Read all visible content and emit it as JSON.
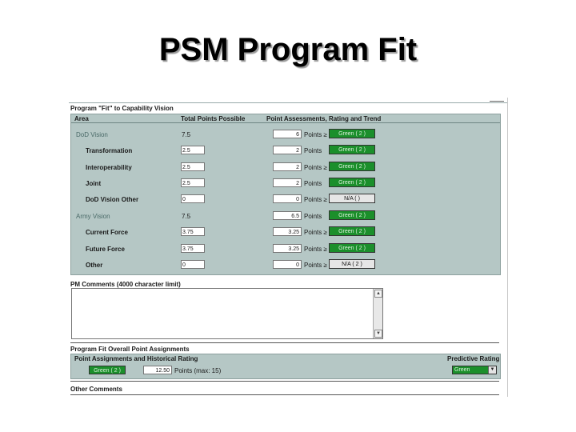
{
  "slide": {
    "title": "PSM Program Fit"
  },
  "capability": {
    "section_title": "Program \"Fit\" to Capability Vision",
    "headers": {
      "area": "Area",
      "total": "Total Points Possible",
      "assessment": "Point Assessments, Rating and Trend"
    },
    "rows": [
      {
        "area": "DoD Vision",
        "total": "7.5",
        "points": "6",
        "unit": "Points",
        "rating": "Green ( 2 )",
        "status": "green"
      },
      {
        "area": "Transformation",
        "total": "2.5",
        "points": "2",
        "unit": "Points",
        "rating": "Green ( 2 )",
        "status": "green"
      },
      {
        "area": "Interoperability",
        "total": "2.5",
        "points": "2",
        "unit": "Points",
        "rating": "Green ( 2 )",
        "status": "green"
      },
      {
        "area": "Joint",
        "total": "2.5",
        "points": "2",
        "unit": "Points",
        "rating": "Green ( 2 )",
        "status": "green"
      },
      {
        "area": "DoD Vision Other",
        "total": "0",
        "points": "0",
        "unit": "Points",
        "rating": "N/A ( )",
        "status": "na"
      },
      {
        "area": "Army Vision",
        "total": "7.5",
        "points": "6.5",
        "unit": "Points",
        "rating": "Green ( 2 )",
        "status": "green"
      },
      {
        "area": "Current Force",
        "total": "3.75",
        "points": "3.25",
        "unit": "Points",
        "rating": "Green ( 2 )",
        "status": "green"
      },
      {
        "area": "Future Force",
        "total": "3.75",
        "points": "3.25",
        "unit": "Points",
        "rating": "Green ( 2 )",
        "status": "green"
      },
      {
        "area": "Other",
        "total": "0",
        "points": "0",
        "unit": "Points",
        "rating": "N/A ( 2 )",
        "status": "na"
      }
    ]
  },
  "comments": {
    "section_title": "PM Comments (4000 character limit)",
    "value": ""
  },
  "overall": {
    "section_title": "Program Fit Overall Point Assignments",
    "assign_label": "Point Assignments and Historical Rating",
    "predictive_label": "Predictive Rating",
    "historical_rating": "Green ( 2 )",
    "total_points": "12.50",
    "max_label": "Points (max: 15)",
    "predictive_value": "Green"
  },
  "other_comments": {
    "section_title": "Other Comments"
  },
  "colors": {
    "panel": "#b5c7c5",
    "green": "#1b8f2b"
  },
  "icons": {
    "scroll_up": "▲",
    "scroll_down": "▼",
    "dropdown": "▼",
    "sort": "≥"
  }
}
